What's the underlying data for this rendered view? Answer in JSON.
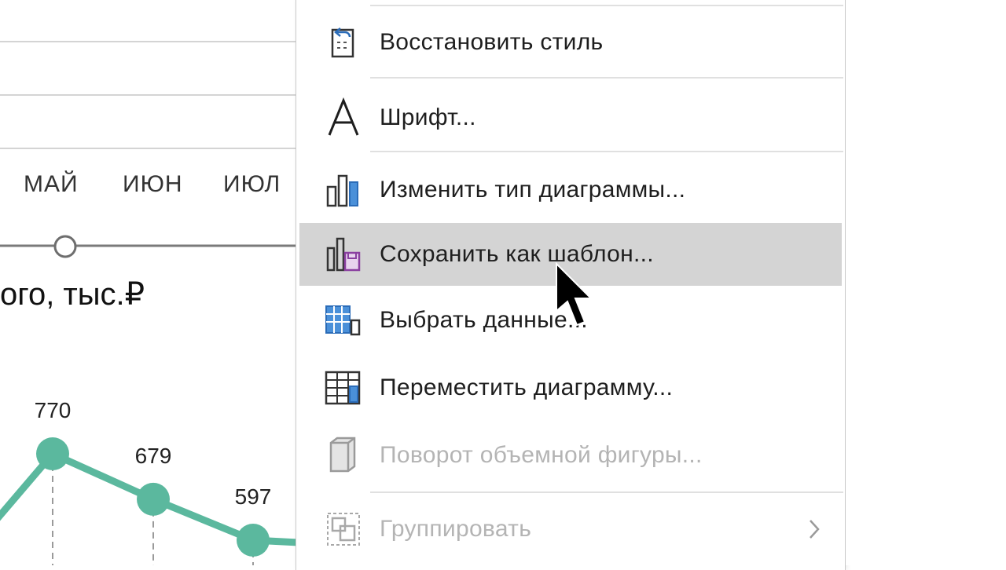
{
  "sheet": {
    "months": [
      "МАЙ",
      "ИЮН",
      "ИЮЛ"
    ],
    "chart_title": "ого, тыс.₽"
  },
  "chart_data": {
    "type": "line",
    "categories": [
      "МАЙ",
      "ИЮН",
      "ИЮЛ"
    ],
    "series": [
      {
        "values": [
          770,
          679,
          597
        ]
      }
    ],
    "data_labels": [
      "770",
      "679",
      "597"
    ],
    "color": "#5bb89e",
    "title": "ого, тыс.₽"
  },
  "context_menu": {
    "items": [
      {
        "label": "Восстановить стиль",
        "icon": "reset-style-icon",
        "enabled": true
      },
      {
        "label": "Шрифт...",
        "icon": "font-icon",
        "enabled": true
      },
      {
        "label": "Изменить тип диаграммы...",
        "icon": "chart-type-icon",
        "enabled": true
      },
      {
        "label": "Сохранить как шаблон...",
        "icon": "save-template-icon",
        "enabled": true,
        "highlighted": true
      },
      {
        "label": "Выбрать данные...",
        "icon": "select-data-icon",
        "enabled": true
      },
      {
        "label": "Переместить диаграмму...",
        "icon": "move-chart-icon",
        "enabled": true
      },
      {
        "label": "Поворот объемной фигуры...",
        "icon": "3d-rotation-icon",
        "enabled": false
      },
      {
        "label": "Группировать",
        "icon": "group-icon",
        "enabled": false,
        "submenu": true
      }
    ],
    "highlight_color": "#d4d4d4",
    "disabled_color": "#b4b4b4"
  }
}
